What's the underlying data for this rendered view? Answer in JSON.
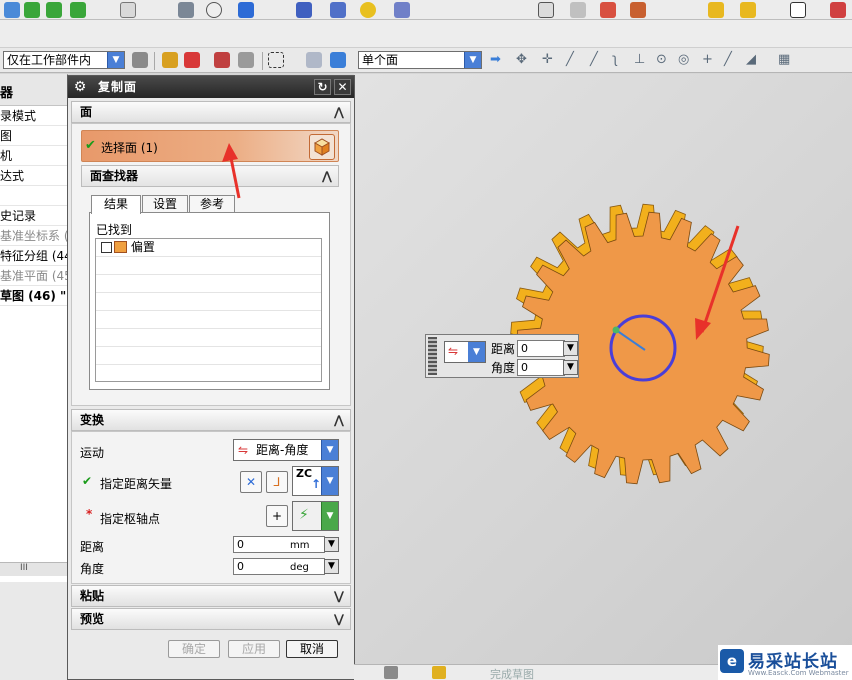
{
  "toolbar": {
    "filter_combo": "仅在工作部件内",
    "face_rule_combo": "单个面",
    "colors": {
      "accent": "#4a7fd6",
      "gear": "#f0a040",
      "arrow": "#e8312a"
    }
  },
  "navigator": {
    "title": "器",
    "items": [
      {
        "label": "录模式",
        "style": "normal"
      },
      {
        "label": "图",
        "style": "normal"
      },
      {
        "label": "机",
        "style": "normal"
      },
      {
        "label": "达式",
        "style": "normal"
      },
      {
        "label": "",
        "style": "normal"
      },
      {
        "label": "史记录",
        "style": "normal"
      },
      {
        "label": "基准坐标系 (",
        "style": "grey"
      },
      {
        "label": "特征分组 (44",
        "style": "normal"
      },
      {
        "label": "基准平面 (45",
        "style": "grey"
      },
      {
        "label": "草图 (46) \"",
        "style": "bold"
      }
    ],
    "scroll_label": "III"
  },
  "dialog": {
    "title": "复制面",
    "section_face": "面",
    "select_face_label": "选择面 (1)",
    "face_finder": "面查找器",
    "tabs": [
      "结果",
      "设置",
      "参考"
    ],
    "found_label": "已找到",
    "found_items": [
      "偏置"
    ],
    "section_transform": "变换",
    "motion_label": "运动",
    "motion_value": "距离-角度",
    "distance_vector_label": "指定距离矢量",
    "axis_combo": "ZC",
    "pivot_label": "指定枢轴点",
    "distance_label": "距离",
    "distance_value": "0",
    "distance_unit": "mm",
    "angle_label": "角度",
    "angle_value": "0",
    "angle_unit": "deg",
    "section_paste": "粘贴",
    "section_preview": "预览",
    "btn_ok": "确定",
    "btn_apply": "应用",
    "btn_cancel": "取消"
  },
  "gear_input": {
    "distance_label": "距离",
    "distance_value": "0",
    "angle_label": "角度",
    "angle_value": "0"
  },
  "statusbar": {
    "item": "完成草图"
  },
  "watermark": {
    "text": "易采站长站",
    "sub": "Www.Easck.Com Webmaster"
  }
}
